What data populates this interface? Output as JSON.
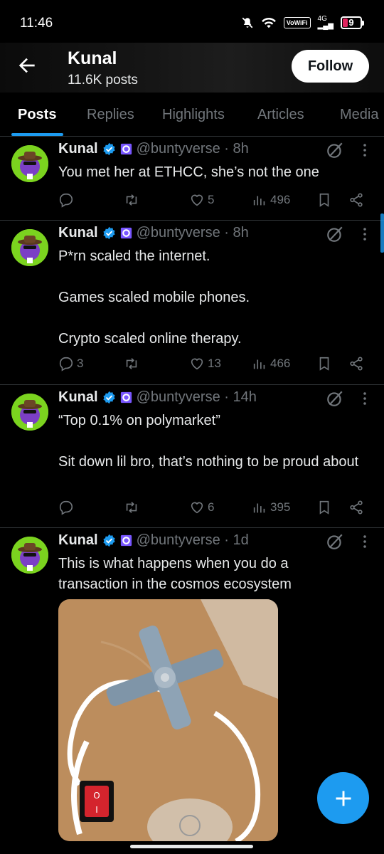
{
  "status_bar": {
    "time": "11:46",
    "vowifi": "VoWiFi",
    "network": "4G",
    "battery": "9"
  },
  "header": {
    "name": "Kunal",
    "posts": "11.6K posts",
    "follow_label": "Follow"
  },
  "tabs": [
    "Posts",
    "Replies",
    "Highlights",
    "Articles",
    "Media"
  ],
  "active_tab": "Posts",
  "tweets": [
    {
      "name": "Kunal",
      "handle": "@buntyverse · 8h",
      "text": "You met her at ETHCC, she’s not the one",
      "replies": "",
      "reposts": "",
      "likes": "5",
      "views": "496"
    },
    {
      "name": "Kunal",
      "handle": "@buntyverse · 8h",
      "text": "P*rn scaled the internet.\n\nGames scaled mobile phones.\n\nCrypto scaled online therapy.",
      "replies": "3",
      "reposts": "",
      "likes": "13",
      "views": "466"
    },
    {
      "name": "Kunal",
      "handle": "@buntyverse · 14h",
      "text": "“Top 0.1% on polymarket”\n\nSit down lil bro, that’s nothing to be proud about",
      "replies": "",
      "reposts": "",
      "likes": "6",
      "views": "395"
    },
    {
      "name": "Kunal",
      "handle": "@buntyverse · 1d",
      "text": "This is what happens when you do a transaction in the cosmos ecosystem",
      "media": {
        "switch_on": "O",
        "switch_off": "I"
      }
    }
  ],
  "icons": {
    "back": "arrow-left-icon",
    "verified": "verified-badge-icon",
    "affiliate": "affiliate-badge-icon",
    "grok": "grok-icon",
    "more": "more-dots-icon",
    "reply": "reply-icon",
    "repost": "repost-icon",
    "like": "heart-icon",
    "views": "views-icon",
    "bookmark": "bookmark-icon",
    "share": "share-icon",
    "compose": "plus-icon"
  },
  "colors": {
    "accent": "#1d9bf0",
    "background": "#000000",
    "text": "#e7e9ea",
    "muted": "#71767b",
    "battery_low": "#e0245e"
  }
}
